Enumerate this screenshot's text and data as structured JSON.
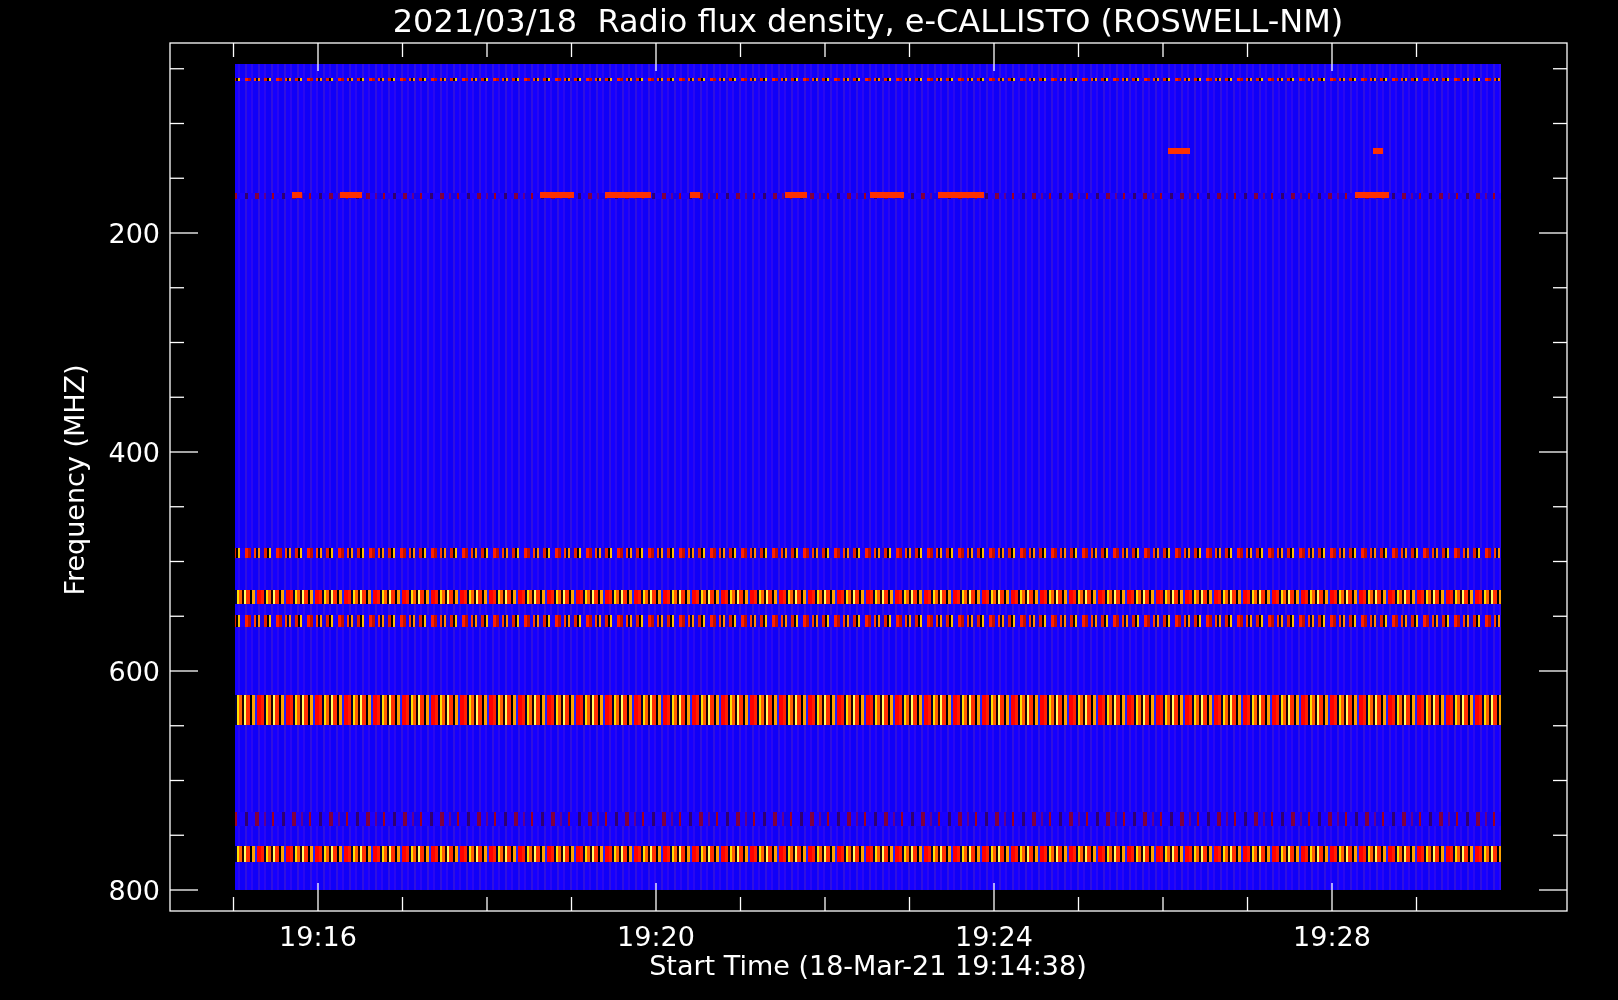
{
  "title": "2021/03/18  Radio flux density, e-CALLISTO (ROSWELL-NM)",
  "xlabel": "Start Time (18-Mar-21 19:14:38)",
  "ylabel": "Frequency (MHZ)",
  "xticks": [
    "19:16",
    "19:20",
    "19:24",
    "19:28"
  ],
  "yticks": [
    "200",
    "400",
    "600",
    "800"
  ]
}
